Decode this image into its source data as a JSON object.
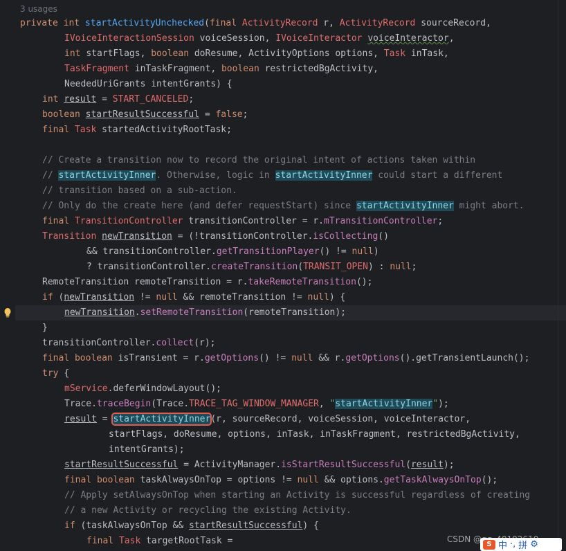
{
  "editor": {
    "usages_hint": "3 usages",
    "lines": [
      "private int startActivityUnchecked(final ActivityRecord r, ActivityRecord sourceRecord,",
      "IVoiceInteractionSession voiceSession, IVoiceInteractor voiceInteractor,",
      "int startFlags, boolean doResume, ActivityOptions options, Task inTask,",
      "TaskFragment inTaskFragment, boolean restrictedBgActivity,",
      "NeededUriGrants intentGrants) {",
      "int result = START_CANCELED;",
      "boolean startResultSuccessful = false;",
      "final Task startedActivityRootTask;",
      "",
      "// Create a transition now to record the original intent of actions taken within",
      "// startActivityInner. Otherwise, logic in startActivityInner could start a different",
      "// transition based on a sub-action.",
      "// Only do the create here (and defer requestStart) since startActivityInner might abort.",
      "final TransitionController transitionController = r.mTransitionController;",
      "Transition newTransition = (!transitionController.isCollecting()",
      "&& transitionController.getTransitionPlayer() != null)",
      "? transitionController.createTransition(TRANSIT_OPEN) : null;",
      "RemoteTransition remoteTransition = r.takeRemoteTransition();",
      "if (newTransition != null && remoteTransition != null) {",
      "newTransition.setRemoteTransition(remoteTransition);",
      "}",
      "transitionController.collect(r);",
      "final boolean isTransient = r.getOptions() != null && r.getOptions().getTransientLaunch();",
      "try {",
      "mService.deferWindowLayout();",
      "Trace.traceBegin(Trace.TRACE_TAG_WINDOW_MANAGER, \"startActivityInner\");",
      "result = startActivityInner(r, sourceRecord, voiceSession, voiceInteractor,",
      "startFlags, doResume, options, inTask, inTaskFragment, restrictedBgActivity,",
      "intentGrants);",
      "startResultSuccessful = ActivityManager.isStartResultSuccessful(result);",
      "final boolean taskAlwaysOnTop = options != null && options.getTaskAlwaysOnTop();",
      "// Apply setAlwaysOnTop when starting an Activity is successful regardless of creating",
      "// a new Activity or recycling the existing Activity.",
      "if (taskAlwaysOnTop && startResultSuccessful) {",
      "final Task targetRootTask ="
    ]
  },
  "overlay": {
    "watermark": "CSDN @qq_40102610",
    "ime_logo": "S",
    "ime_items": [
      "中",
      "·,",
      "拼",
      "⚙"
    ]
  },
  "icons": {
    "intention_bulb": "lightbulb-icon",
    "ime_settings": "gear-icon"
  },
  "colors": {
    "background": "#1e1f22",
    "keyword": "#cf8e6d",
    "method": "#56a8f5",
    "string": "#6aab73",
    "comment": "#7a7e85",
    "highlight": "#1e4b57",
    "red_box": "#e55a4f"
  }
}
